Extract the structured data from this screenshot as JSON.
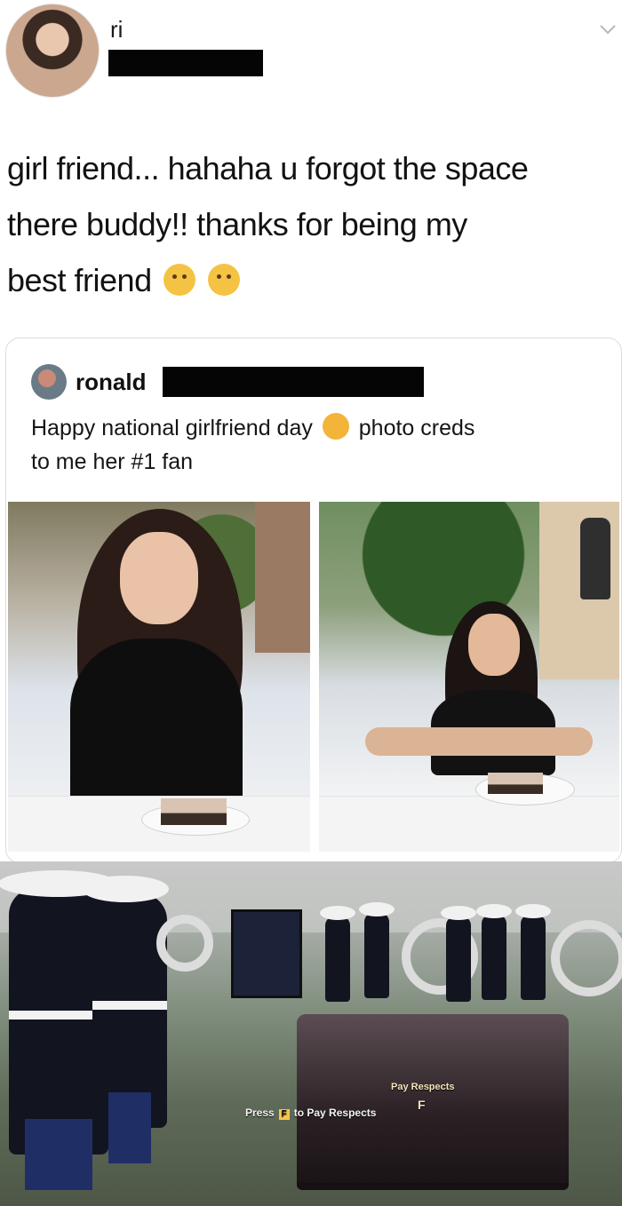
{
  "tweet": {
    "author_name": "ri",
    "text_line_1": "girl friend... hahaha u forgot the space",
    "text_line_2": "there buddy!! thanks for being my",
    "text_line_3": "best friend"
  },
  "quoted_tweet": {
    "author_name": "ronald",
    "text_part_1": "Happy national girlfriend day",
    "text_part_2": "photo creds",
    "text_part_3": "to me her #1 fan"
  },
  "game_hud": {
    "press_label": "Press",
    "key": "F",
    "action_label": "to Pay Respects",
    "prompt_small": "Pay Respects",
    "prompt_key": "F"
  },
  "icons": {
    "chevron": "chevron-down-icon",
    "emoji_1": "kissing-face-icon",
    "emoji_2": "relieved-face-icon",
    "emoji_3": "smiling-face-with-hearts-icon"
  }
}
